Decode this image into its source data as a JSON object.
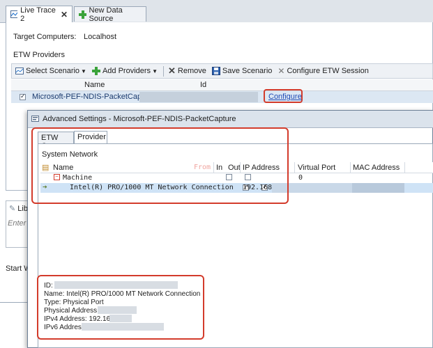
{
  "tabs": [
    {
      "label": "Live Trace 2",
      "icon": "trace-icon"
    },
    {
      "label": "New Data Source",
      "icon": "add-icon"
    }
  ],
  "main": {
    "target_label": "Target Computers:",
    "target_value": "Localhost",
    "providers_label": "ETW Providers"
  },
  "toolbar": {
    "select_scenario": "Select Scenario",
    "add_providers": "Add Providers",
    "remove": "Remove",
    "save_scenario": "Save Scenario",
    "configure_session": "Configure ETW Session"
  },
  "grid": {
    "col_name": "Name",
    "col_id": "Id",
    "row_name": "Microsoft-PEF-NDIS-PacketCapture",
    "row_checked": true,
    "configure": "Configure"
  },
  "background": {
    "lib_label": "Lib",
    "enter_label": "Enter d",
    "start_label": "Start W"
  },
  "dialog": {
    "title": "Advanced Settings - Microsoft-PEF-NDIS-PacketCapture",
    "tab_core": "ETW Core",
    "tab_provider": "Provider",
    "section": "System Network",
    "cols": {
      "name": "Name",
      "in": "In",
      "out": "Out",
      "ip": "IP Address",
      "vport": "Virtual Port",
      "mac": "MAC Address"
    },
    "watermark": "From",
    "rows": [
      {
        "name": "Machine",
        "in": false,
        "out": false,
        "ip": "",
        "vport": "0"
      },
      {
        "name": "Intel(R) PRO/1000 MT Network Connection",
        "in": true,
        "out": true,
        "ip": "192.168.",
        "vport": ""
      }
    ]
  },
  "details": {
    "id": "ID:",
    "name": "Name: Intel(R) PRO/1000 MT Network Connection",
    "type": "Type: Physical Port",
    "physical": "Physical Address:",
    "ipv4": "IPv4 Address: 192.168",
    "ipv6": "IPv6 Address"
  },
  "colors": {
    "accent": "#d33b2b",
    "link": "#1f4bb5",
    "selection": "#cfe3f6"
  }
}
